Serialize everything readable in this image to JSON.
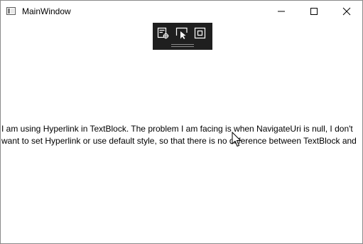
{
  "window": {
    "title": "MainWindow",
    "icon": "app-window-icon",
    "controls": {
      "minimize_icon": "minimize-icon",
      "maximize_icon": "maximize-icon",
      "close_icon": "close-icon"
    }
  },
  "debug_toolbar": {
    "tools": [
      {
        "icon": "live-visual-tree-icon"
      },
      {
        "icon": "select-element-icon"
      },
      {
        "icon": "display-layout-adorners-icon"
      }
    ],
    "background": "#1f1f1f"
  },
  "content": {
    "text_block": "I am using Hyperlink in TextBlock. The problem I am facing is when NavigateUri is null, I don't\nwant to set Hyperlink or use default style, so that there is no difference between TextBlock and"
  },
  "cursor": {
    "icon": "mouse-pointer-icon"
  }
}
